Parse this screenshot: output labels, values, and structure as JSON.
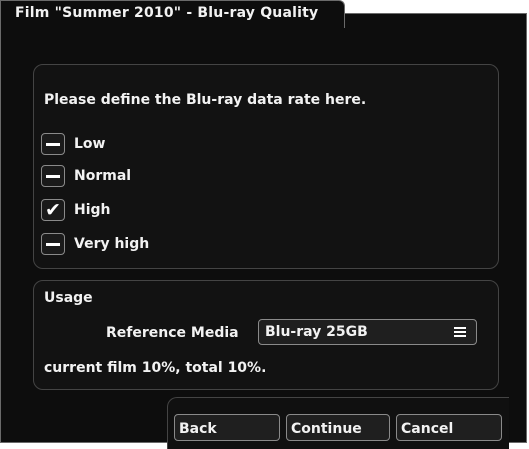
{
  "window": {
    "title": "Film \"Summer 2010\" - Blu-ray Quality"
  },
  "quality": {
    "prompt": "Please define the Blu-ray data rate here.",
    "options": [
      {
        "label": "Low",
        "checked": false
      },
      {
        "label": "Normal",
        "checked": false
      },
      {
        "label": "High",
        "checked": true
      },
      {
        "label": "Very high",
        "checked": false
      }
    ]
  },
  "usage": {
    "title": "Usage",
    "reference_media_label": "Reference Media",
    "reference_media_value": "Blu-ray 25GB",
    "status": "current film 10%, total 10%."
  },
  "footer": {
    "back_label": "Back",
    "continue_label": "Continue",
    "cancel_label": "Cancel"
  }
}
